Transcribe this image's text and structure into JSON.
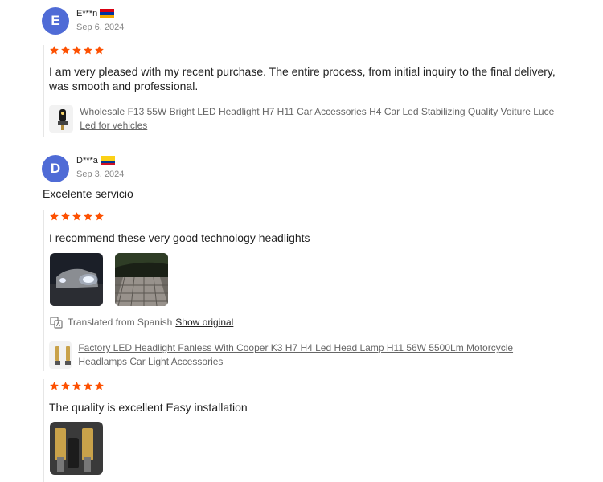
{
  "colors": {
    "star": "#fd5001",
    "avatar": "#4f6bd6",
    "link": "#666666"
  },
  "reviews": [
    {
      "initial": "E",
      "author": "E***n",
      "flag": "armenia-flag",
      "date": "Sep 6, 2024",
      "rating": 5,
      "text": "I am very pleased with my recent purchase. The entire process, from initial inquiry to the final delivery, was smooth and professional.",
      "product": "Wholesale F13 55W Bright LED Headlight H7 H11 Car Accessories H4 Car Led Stabilizing Quality Voiture Luce Led for vehicles"
    },
    {
      "initial": "D",
      "author": "D***a",
      "flag": "colombia-flag",
      "date": "Sep 3, 2024",
      "comment": "Excelente servicio",
      "rating": 5,
      "text": "I recommend these very good technology headlights",
      "translated_note": "Translated from Spanish",
      "show_original": "Show original",
      "product": "Factory LED Headlight Fanless With Cooper K3 H7 H4 Led Head Lamp H11 56W 5500Lm Motorcycle Headlamps Car Light Accessories"
    },
    {
      "rating": 5,
      "text": "The quality is excellent Easy installation"
    }
  ]
}
